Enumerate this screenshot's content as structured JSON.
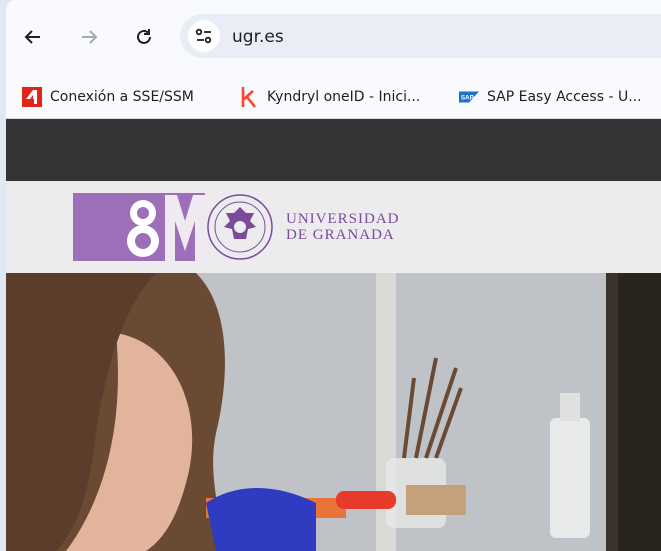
{
  "browser": {
    "url": "ugr.es",
    "bookmarks": [
      {
        "label": "Conexión a SSE/SSM",
        "icon": "red-4-icon"
      },
      {
        "label": "Kyndryl oneID - Inici...",
        "icon": "kyndryl-k-icon"
      },
      {
        "label": "SAP Easy Access - U...",
        "icon": "sap-logo-icon"
      }
    ]
  },
  "site": {
    "logo_8m": "8M",
    "university_line1": "UNIVERSIDAD",
    "university_line2": "DE GRANADA",
    "brand_color": "#9c6fb8"
  }
}
